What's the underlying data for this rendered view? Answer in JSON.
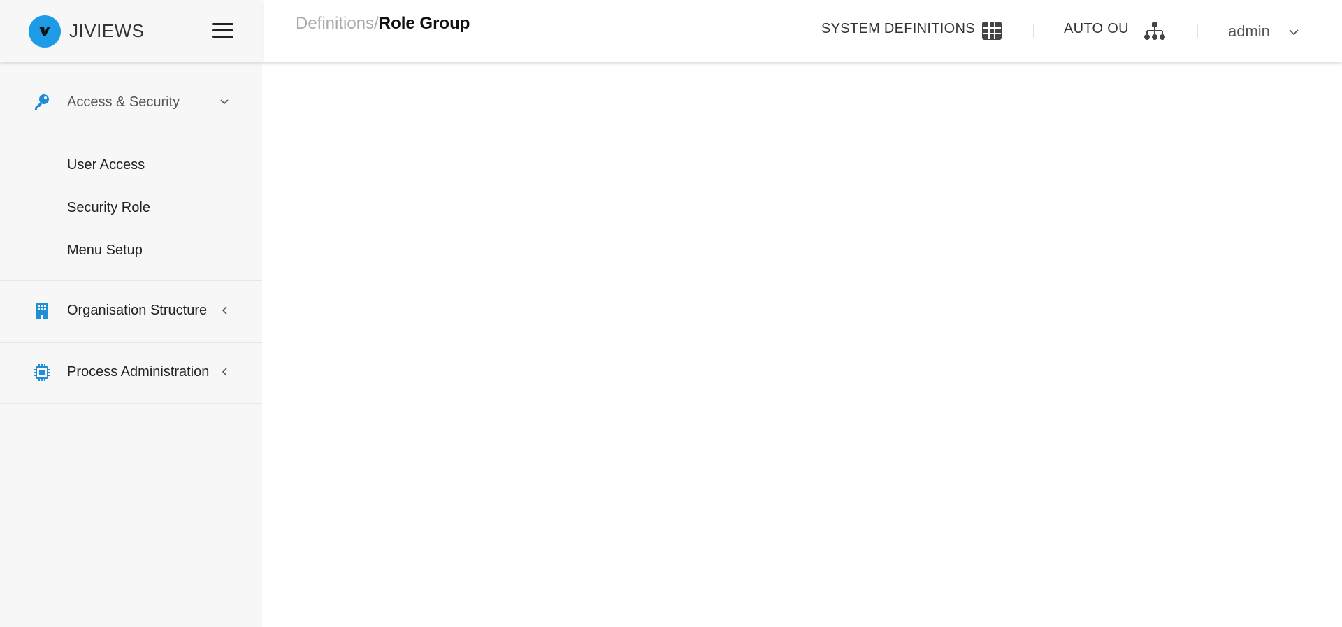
{
  "app": {
    "name": "JIVIEWS",
    "logo_letter": "V",
    "accent_color": "#1e9be6"
  },
  "sidebar": {
    "groups": [
      {
        "label": "Access & Security",
        "icon": "key-icon",
        "expanded": true,
        "items": [
          {
            "label": "User Access"
          },
          {
            "label": "Security Role"
          },
          {
            "label": "Menu Setup"
          }
        ]
      },
      {
        "label": "Organisation Structure",
        "icon": "building-icon",
        "expanded": false
      },
      {
        "label": "Process Administration",
        "icon": "chip-icon",
        "expanded": false
      }
    ]
  },
  "header": {
    "breadcrumb": {
      "parent": "Definitions",
      "separator": "/",
      "current": "Role Group"
    },
    "system_definitions": {
      "label": "SYSTEM DEFINITIONS",
      "icon": "grid-icon"
    },
    "auto_ou": {
      "label": "AUTO OU",
      "icon": "org-chart-icon"
    },
    "user": {
      "name": "admin"
    }
  }
}
